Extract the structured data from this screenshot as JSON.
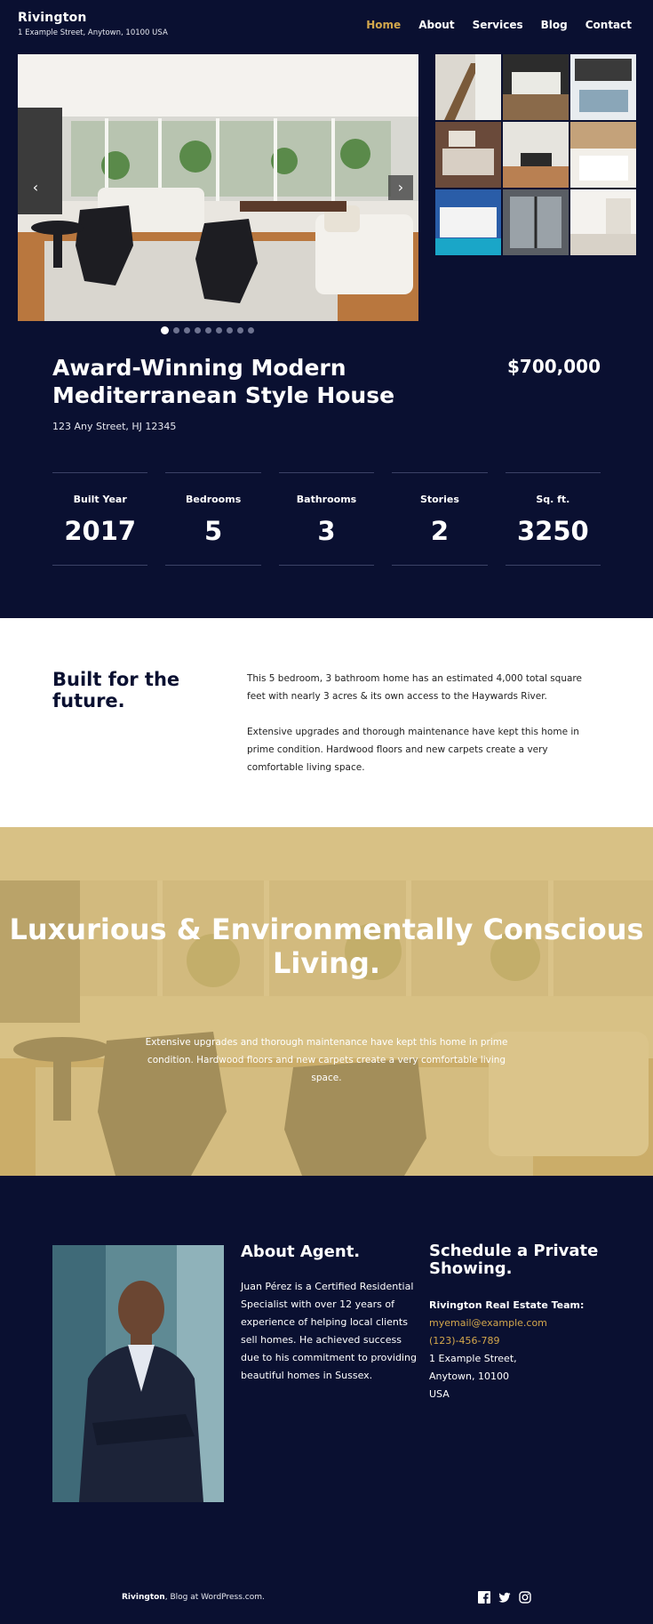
{
  "header": {
    "site_title": "Rivington",
    "site_description": "1 Example Street, Anytown, 10100 USA",
    "nav": [
      {
        "label": "Home",
        "active": true
      },
      {
        "label": "About",
        "active": false
      },
      {
        "label": "Services",
        "active": false
      },
      {
        "label": "Blog",
        "active": false
      },
      {
        "label": "Contact",
        "active": false
      }
    ]
  },
  "gallery": {
    "prev_glyph": "‹",
    "next_glyph": "›",
    "dot_count": 9,
    "active_dot": 1,
    "thumb_count": 9
  },
  "listing": {
    "title": "Award-Winning Modern Mediterranean Style House",
    "price": "$700,000",
    "address": "123 Any Street, HJ 12345",
    "stats": [
      {
        "label": "Built Year",
        "value": "2017"
      },
      {
        "label": "Bedrooms",
        "value": "5"
      },
      {
        "label": "Bathrooms",
        "value": "3"
      },
      {
        "label": "Stories",
        "value": "2"
      },
      {
        "label": "Sq. ft.",
        "value": "3250"
      }
    ]
  },
  "intro": {
    "heading": "Built for the future.",
    "paragraphs": [
      "This 5 bedroom, 3 bathroom home has an estimated 4,000 total square feet with nearly 3 acres & its own access to the Haywards River.",
      "Extensive upgrades and thorough maintenance have kept this home in prime condition. Hardwood floors and new carpets create a very comfortable living space."
    ]
  },
  "banner": {
    "title": "Luxurious & Environmentally Conscious Living.",
    "text": "Extensive upgrades and thorough maintenance have kept this home in prime condition. Hardwood floors and new carpets create a very comfortable living space.",
    "overlay_color": "#d3b56c"
  },
  "agent": {
    "heading": "About Agent.",
    "bio": "Juan Pérez is a Certified Residential Specialist with over 12 years of experience of helping local clients sell homes. He achieved success due to his commitment to providing beautiful homes in Sussex."
  },
  "schedule": {
    "heading": "Schedule a Private Showing.",
    "team": "Rivington Real Estate Team:",
    "email": "myemail@example.com",
    "phone": "(123)-456-789",
    "address_line1": "1 Example Street,",
    "address_line2": "Anytown, 10100",
    "address_line3": "USA"
  },
  "footer": {
    "site_link": "Rivington",
    "credit_rest": ", Blog at WordPress.com.",
    "social_icons": [
      "facebook-icon",
      "twitter-icon",
      "instagram-icon"
    ]
  },
  "colors": {
    "background": "#0a1031",
    "accent": "#d3a74c",
    "white_section": "#ffffff"
  }
}
